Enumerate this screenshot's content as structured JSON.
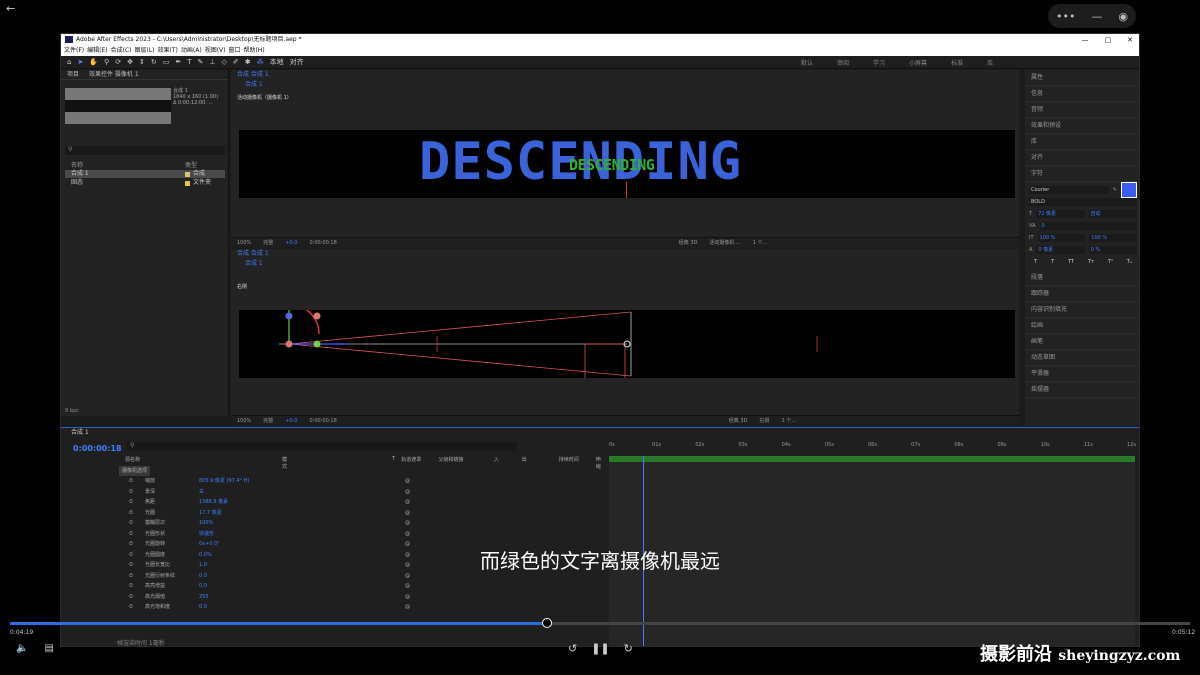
{
  "app": {
    "title": "Adobe After Effects 2023 - C:\\Users\\Administrator\\Desktop\\无标题项目.aep *",
    "menu": [
      "文件(F)",
      "编辑(E)",
      "合成(C)",
      "图层(L)",
      "效果(T)",
      "动画(A)",
      "视图(V)",
      "窗口",
      "帮助(H)"
    ],
    "workspaces": [
      "默认",
      "审阅",
      "学习",
      "小屏幕",
      "标准",
      "库"
    ],
    "toolbar_align": "对齐",
    "toolbar_local": "本地"
  },
  "project": {
    "tab": "项目",
    "tab2": "效果控件 摄像机 1",
    "comp_name": "合成 1",
    "comp_size": "1840 x 160 (1.00)",
    "comp_duration": "Δ 0:00:12:00, ...",
    "header_name": "名称",
    "header_type": "类型",
    "rows": [
      {
        "name": "合成 1",
        "type": "合成"
      },
      {
        "name": "固态",
        "type": "文件夹"
      }
    ],
    "bpc": "8 bpc"
  },
  "viewer1": {
    "tab": "合成 合成 1",
    "sub": "合成 1",
    "label": "活动摄像机（摄像机 1）",
    "big_text": "DESCENDING",
    "green_text": "DESCENDING",
    "zoom": "100%",
    "quality": "完整",
    "exposure": "+0.0",
    "time": "0:00:00:18",
    "renderer": "经典 3D",
    "camera": "活动摄像机 ...",
    "views": "1 个..."
  },
  "viewer2": {
    "tab": "合成 合成 1",
    "sub": "合成 1",
    "label": "右侧",
    "zoom": "100%",
    "quality": "完整",
    "exposure": "+0.0",
    "time": "0:00:00:18",
    "renderer": "经典 3D",
    "camera": "右侧",
    "views": "1 个..."
  },
  "rightpanel": {
    "items": [
      "属性",
      "信息",
      "音频",
      "效果和预设",
      "库",
      "对齐",
      "字符"
    ],
    "font": "Courier",
    "style": "BOLD",
    "size": "72 像素",
    "leading": "自动",
    "tracking": "0",
    "scale_v": "100 %",
    "scale_h": "100 %",
    "baseline": "0 像素",
    "tsume": "0 %",
    "bottom_items": [
      "段落",
      "跟踪器",
      "内容识别填充",
      "绘画",
      "画笔",
      "动态草图",
      "平滑器",
      "摇摆器"
    ],
    "text_color": "#3c5cf0"
  },
  "timeline": {
    "tab": "合成 1",
    "time": "0:00:00:18",
    "header": [
      "源名称",
      "模式",
      "T",
      "轨道遮罩",
      "父级和链接",
      "入",
      "出",
      "持续时间",
      "伸缩"
    ],
    "layer": "摄像机选项",
    "props": [
      {
        "name": "缩放",
        "value": "805.9 像素 (97.4° H)"
      },
      {
        "name": "景深",
        "value": "关"
      },
      {
        "name": "焦距",
        "value": "1388.9 像素"
      },
      {
        "name": "光圈",
        "value": "17.7 像素"
      },
      {
        "name": "模糊层次",
        "value": "100%"
      },
      {
        "name": "光圈形状",
        "value": "快速形"
      },
      {
        "name": "光圈旋转",
        "value": "0x+0.0°"
      },
      {
        "name": "光圈圆度",
        "value": "0.0%"
      },
      {
        "name": "光圈长宽比",
        "value": "1.0"
      },
      {
        "name": "光圈衍射条纹",
        "value": "0.0"
      },
      {
        "name": "高亮增益",
        "value": "0.0"
      },
      {
        "name": "高光阈值",
        "value": "255"
      },
      {
        "name": "高光饱和度",
        "value": "0.0"
      }
    ],
    "ruler": [
      "0s",
      "01s",
      "02s",
      "03s",
      "04s",
      "05s",
      "06s",
      "07s",
      "08s",
      "09s",
      "10s",
      "11s",
      "12s"
    ],
    "footer": "帧渲染时间 1毫秒"
  },
  "subtitle": "而绿色的文字离摄像机最远",
  "player": {
    "current": "0:04:19",
    "total": "0:05:12",
    "progress": 0.455
  },
  "watermark": {
    "cn": "摄影前沿",
    "en": "sheyingzyz.com"
  }
}
